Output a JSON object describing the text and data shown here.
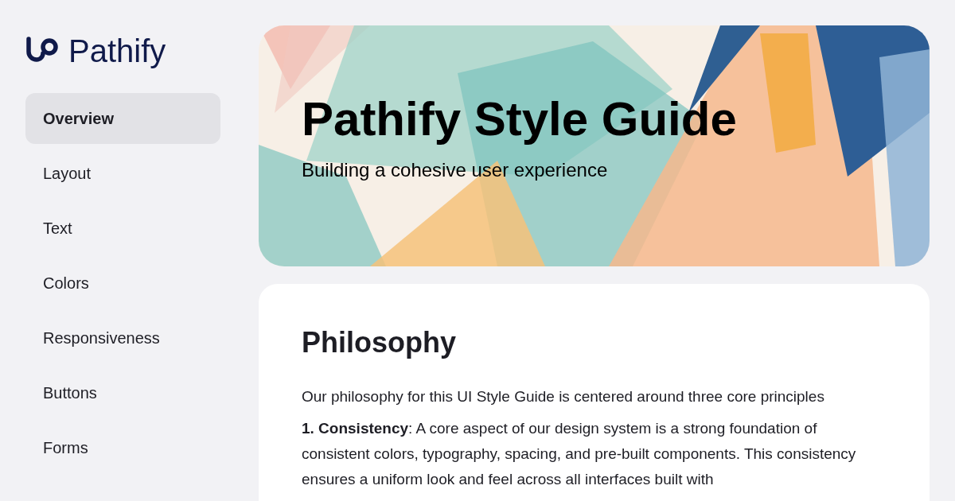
{
  "brand": {
    "name": "Pathify"
  },
  "sidebar": {
    "items": [
      {
        "label": "Overview",
        "selected": true
      },
      {
        "label": "Layout",
        "selected": false
      },
      {
        "label": "Text",
        "selected": false
      },
      {
        "label": "Colors",
        "selected": false
      },
      {
        "label": "Responsiveness",
        "selected": false
      },
      {
        "label": "Buttons",
        "selected": false
      },
      {
        "label": "Forms",
        "selected": false
      }
    ]
  },
  "hero": {
    "title": "Pathify Style Guide",
    "subtitle": "Building a cohesive user experience"
  },
  "content": {
    "heading": "Philosophy",
    "paragraphs": [
      "Our philosophy for this UI Style Guide is centered around three core principles",
      "**1. Consistency**: A core aspect of our design system is a strong foundation of consistent colors, typography, spacing, and pre-built components. This consistency ensures a uniform look and feel across all interfaces built with"
    ]
  }
}
